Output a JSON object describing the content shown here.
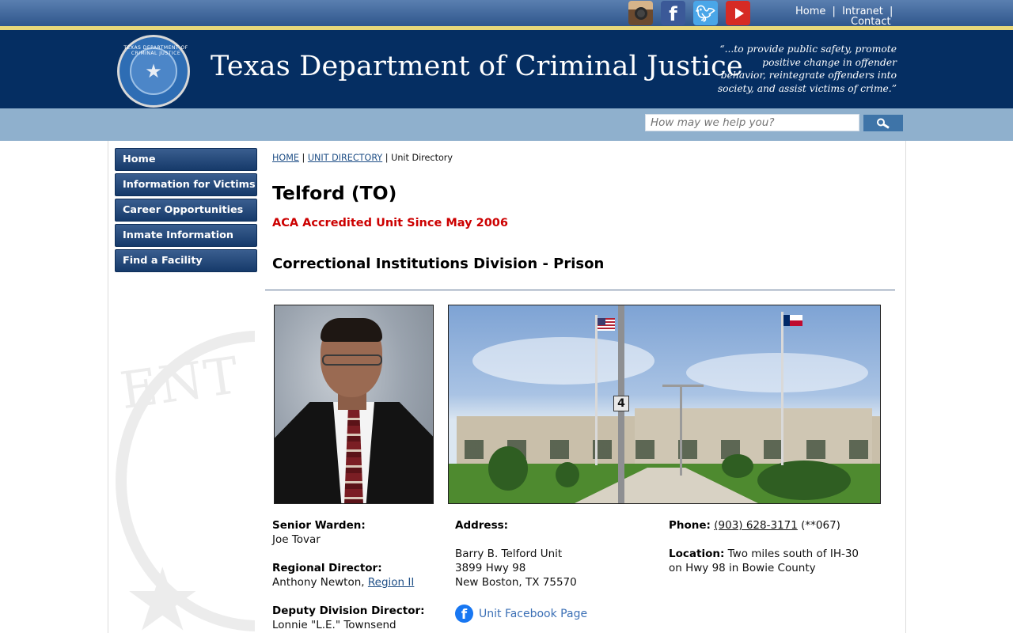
{
  "topbar": {
    "social_icons": [
      "instagram-icon",
      "facebook-icon",
      "twitter-icon",
      "youtube-icon"
    ],
    "links": [
      "Home",
      "Intranet",
      "Contact"
    ],
    "separator": "|"
  },
  "header": {
    "title": "Texas Department of Criminal Justice",
    "seal_text": "TEXAS DEPARTMENT OF CRIMINAL JUSTICE",
    "motto": "“...to provide public safety, promote positive change in offender behavior, reintegrate offenders into society, and assist victims of crime.”"
  },
  "search": {
    "placeholder": "How may we help you?",
    "button_icon": "search-icon"
  },
  "nav": {
    "items": [
      "Home",
      "Information for Victims",
      "Career Opportunities",
      "Inmate Information",
      "Find a Facility"
    ]
  },
  "breadcrumb": {
    "home": "HOME",
    "sep1": "|",
    "directory": "UNIT DIRECTORY",
    "sep2": "|",
    "current": "Unit Directory"
  },
  "unit": {
    "title": "Telford (TO)",
    "accreditation": "ACA Accredited Unit Since May 2006",
    "division": "Correctional Institutions Division - Prison"
  },
  "staff": {
    "senior_warden_label": "Senior Warden:",
    "senior_warden": "Joe Tovar",
    "regional_director_label": "Regional Director:",
    "regional_director": "Anthony Newton,",
    "region_link": "Region II",
    "deputy_label": "Deputy Division Director:",
    "deputy": "Lonnie \"L.E.\" Townsend"
  },
  "address": {
    "label": "Address:",
    "line1": "Barry B. Telford Unit",
    "line2": "3899 Hwy 98",
    "line3": "New Boston, TX 75570",
    "facebook_link": "Unit Facebook Page"
  },
  "contact": {
    "phone_label": "Phone:",
    "phone": "(903) 628-3171",
    "phone_ext": "(**067)",
    "location_label": "Location:",
    "location": "Two miles south of IH-30 on Hwy 98 in Bowie County"
  },
  "facility_photo": {
    "sign_number": "4"
  },
  "colors": {
    "header_bg": "#052e62",
    "nav_bg": "#1e426f",
    "accent_red": "#cc0000",
    "link": "#1f4f86"
  }
}
